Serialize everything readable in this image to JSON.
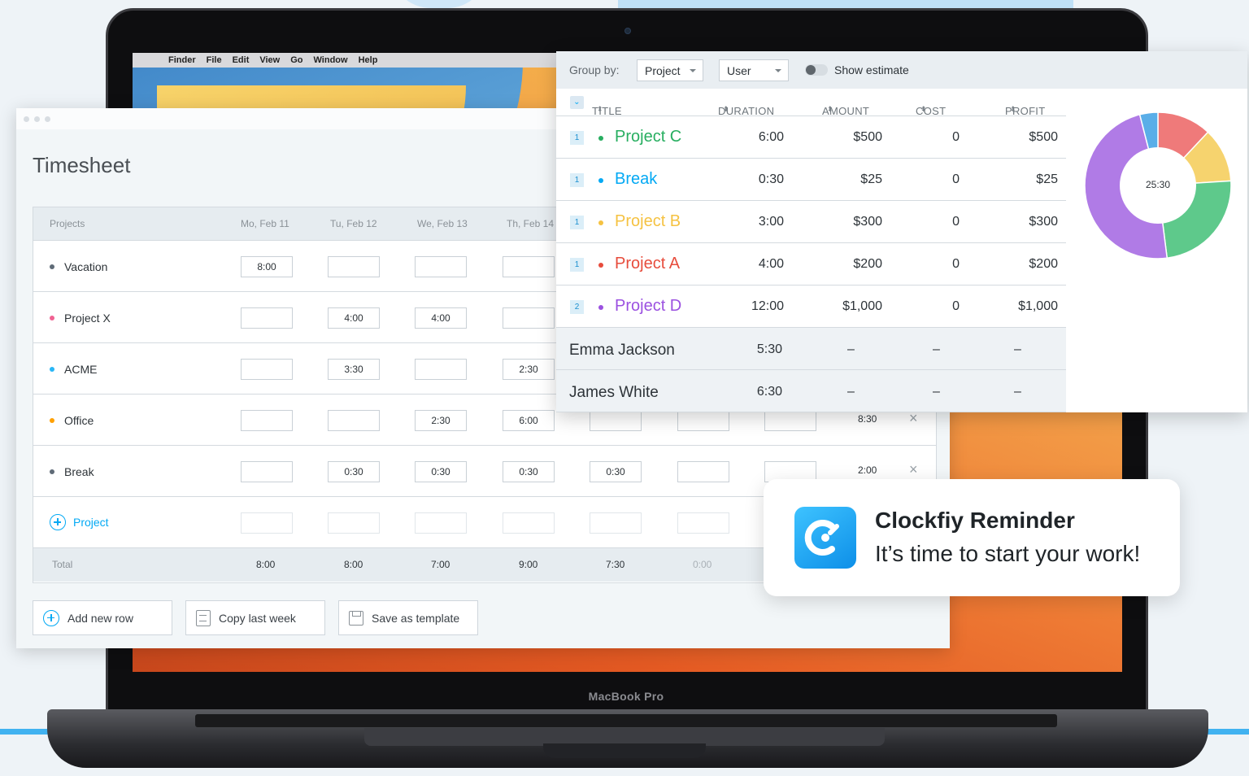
{
  "device": {
    "label": "MacBook Pro",
    "menubar": [
      "Finder",
      "File",
      "Edit",
      "View",
      "Go",
      "Window",
      "Help"
    ]
  },
  "timesheet": {
    "title": "Timesheet",
    "columns": [
      "Projects",
      "Mo, Feb 11",
      "Tu, Feb 12",
      "We, Feb 13",
      "Th, Feb 14"
    ],
    "rows": [
      {
        "name": "Vacation",
        "color": "#5f6b77",
        "cells": [
          "8:00",
          "",
          "",
          "",
          "",
          "",
          ""
        ],
        "total": ""
      },
      {
        "name": "Project X",
        "color": "#f06292",
        "cells": [
          "",
          "4:00",
          "4:00",
          "",
          "",
          "",
          ""
        ],
        "total": ""
      },
      {
        "name": "ACME",
        "color": "#29b6f6",
        "cells": [
          "",
          "3:30",
          "",
          "2:30",
          "",
          "",
          ""
        ],
        "total": ""
      },
      {
        "name": "Office",
        "color": "#ffa000",
        "cells": [
          "",
          "",
          "2:30",
          "6:00",
          "",
          "",
          ""
        ],
        "total": "8:30"
      },
      {
        "name": "Break",
        "color": "#5f6b77",
        "cells": [
          "",
          "0:30",
          "0:30",
          "0:30",
          "0:30",
          "",
          ""
        ],
        "total": "2:00"
      }
    ],
    "add_project_label": "Project",
    "total_label": "Total",
    "totals": [
      "8:00",
      "8:00",
      "7:00",
      "9:00",
      "7:30",
      "0:00"
    ],
    "buttons": {
      "add_row": "Add new row",
      "copy_week": "Copy last week",
      "save_template": "Save as template"
    }
  },
  "report": {
    "group_by_label": "Group by:",
    "group_primary": "Project",
    "group_secondary": "User",
    "show_estimate": "Show estimate",
    "columns": {
      "title": "TITLE",
      "duration": "DURATION",
      "amount": "AMOUNT",
      "cost": "COST",
      "profit": "PROFIT"
    },
    "projects": [
      {
        "count": "1",
        "title": "Project C",
        "color": "#27ae60",
        "duration": "6:00",
        "amount": "$500",
        "cost": "0",
        "profit": "$500"
      },
      {
        "count": "1",
        "title": "Break",
        "color": "#03a9f4",
        "duration": "0:30",
        "amount": "$25",
        "cost": "0",
        "profit": "$25"
      },
      {
        "count": "1",
        "title": "Project B",
        "color": "#f5c242",
        "duration": "3:00",
        "amount": "$300",
        "cost": "0",
        "profit": "$300"
      },
      {
        "count": "1",
        "title": "Project A",
        "color": "#e74c3c",
        "duration": "4:00",
        "amount": "$200",
        "cost": "0",
        "profit": "$200"
      },
      {
        "count": "2",
        "title": "Project D",
        "color": "#9b51e0",
        "duration": "12:00",
        "amount": "$1,000",
        "cost": "0",
        "profit": "$1,000"
      }
    ],
    "users": [
      {
        "name": "Emma Jackson",
        "duration": "5:30",
        "amount": "–",
        "cost": "–",
        "profit": "–"
      },
      {
        "name": "James White",
        "duration": "6:30",
        "amount": "–",
        "cost": "–",
        "profit": "–"
      }
    ],
    "donut": {
      "center_label": "25:30",
      "slices": [
        {
          "value": 0.12,
          "color": "#ef7a7a"
        },
        {
          "value": 0.12,
          "color": "#f6d36e"
        },
        {
          "value": 0.24,
          "color": "#5ec98b"
        },
        {
          "value": 0.48,
          "color": "#b07be6"
        },
        {
          "value": 0.04,
          "color": "#5aaee8"
        }
      ]
    }
  },
  "reminder": {
    "title": "Clockfiy Reminder",
    "message": "It’s time to start your work!"
  }
}
